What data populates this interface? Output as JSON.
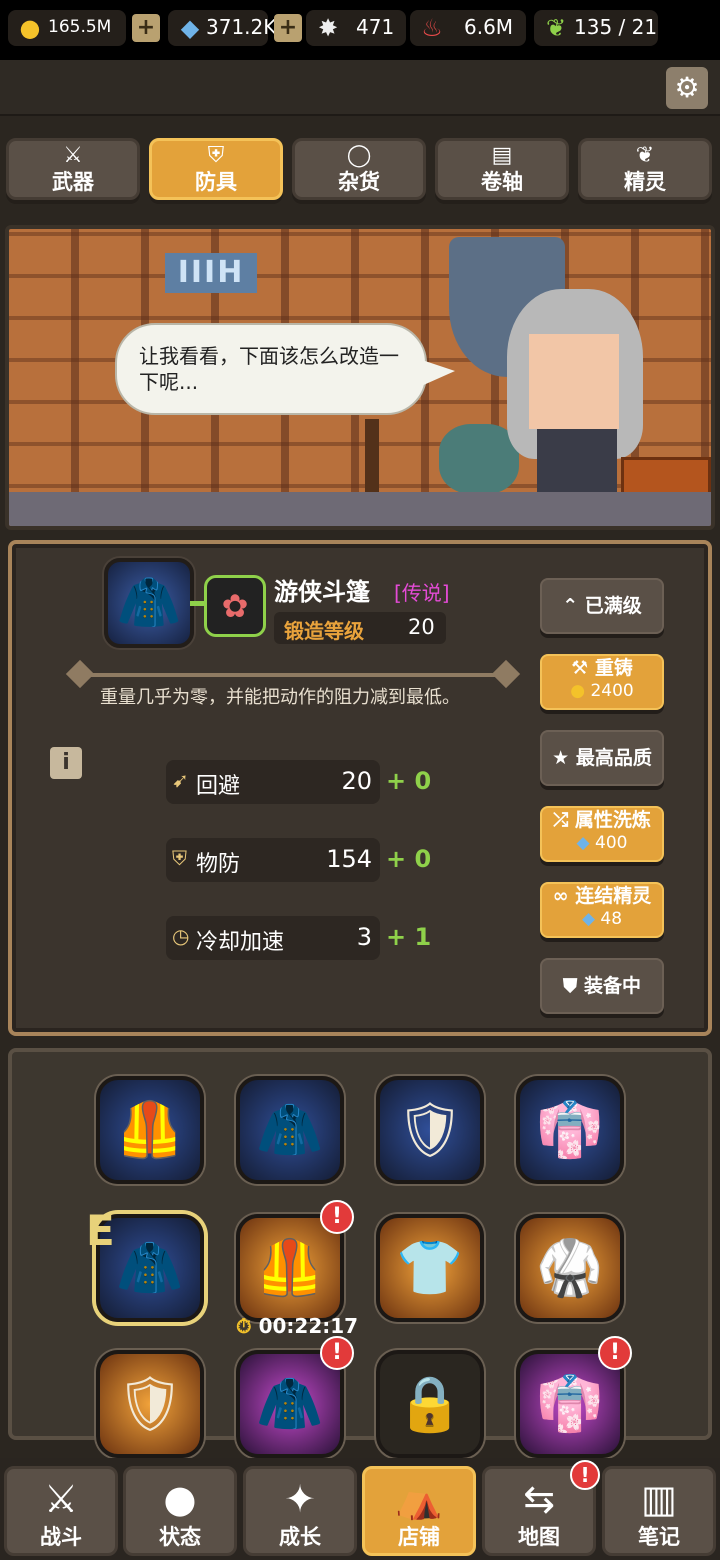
{
  "resources": {
    "gold": "165.5M",
    "gems": "371.2K",
    "stars": "471",
    "fire": "6.6M",
    "leaf": "135 / 21"
  },
  "tabs": [
    {
      "label": "武器",
      "icon": "sword-icon"
    },
    {
      "label": "防具",
      "icon": "shield-icon"
    },
    {
      "label": "杂货",
      "icon": "ring-icon"
    },
    {
      "label": "卷轴",
      "icon": "scroll-icon"
    },
    {
      "label": "精灵",
      "icon": "wings-icon"
    }
  ],
  "scene": {
    "window_text": "IIIH",
    "speech": "让我看看，下面该怎么改造一下呢..."
  },
  "item": {
    "name": "游侠斗篷",
    "rarity": "[传说]",
    "forge_label": "锻造等级",
    "forge_level": "20",
    "description": "重量几乎为零，并能把动作的阻力减到最低。",
    "info_glyph": "i",
    "stats": [
      {
        "name": "回避",
        "value": "20",
        "bonus": "+ 0"
      },
      {
        "name": "物防",
        "value": "154",
        "bonus": "+ 0"
      },
      {
        "name": "冷却加速",
        "value": "3",
        "bonus": "+ 1"
      }
    ]
  },
  "actions": {
    "maxed": "已满级",
    "recast": "重铸",
    "recast_cost": "2400",
    "best_quality": "最高品质",
    "reroll": "属性洗炼",
    "reroll_cost": "400",
    "link_spirit": "连结精灵",
    "link_cost": "48",
    "equipped": "装备中"
  },
  "inventory": {
    "equip_mark": "E",
    "timer": "00:22:17",
    "alert_glyph": "!"
  },
  "nav": [
    {
      "label": "战斗"
    },
    {
      "label": "状态"
    },
    {
      "label": "成长"
    },
    {
      "label": "店铺"
    },
    {
      "label": "地图"
    },
    {
      "label": "笔记"
    }
  ],
  "colors": {
    "accent_orange": "#e3a23a",
    "legend_purple": "#e44bd6",
    "bonus_green": "#8fd14a",
    "alert_red": "#e23a3a"
  }
}
